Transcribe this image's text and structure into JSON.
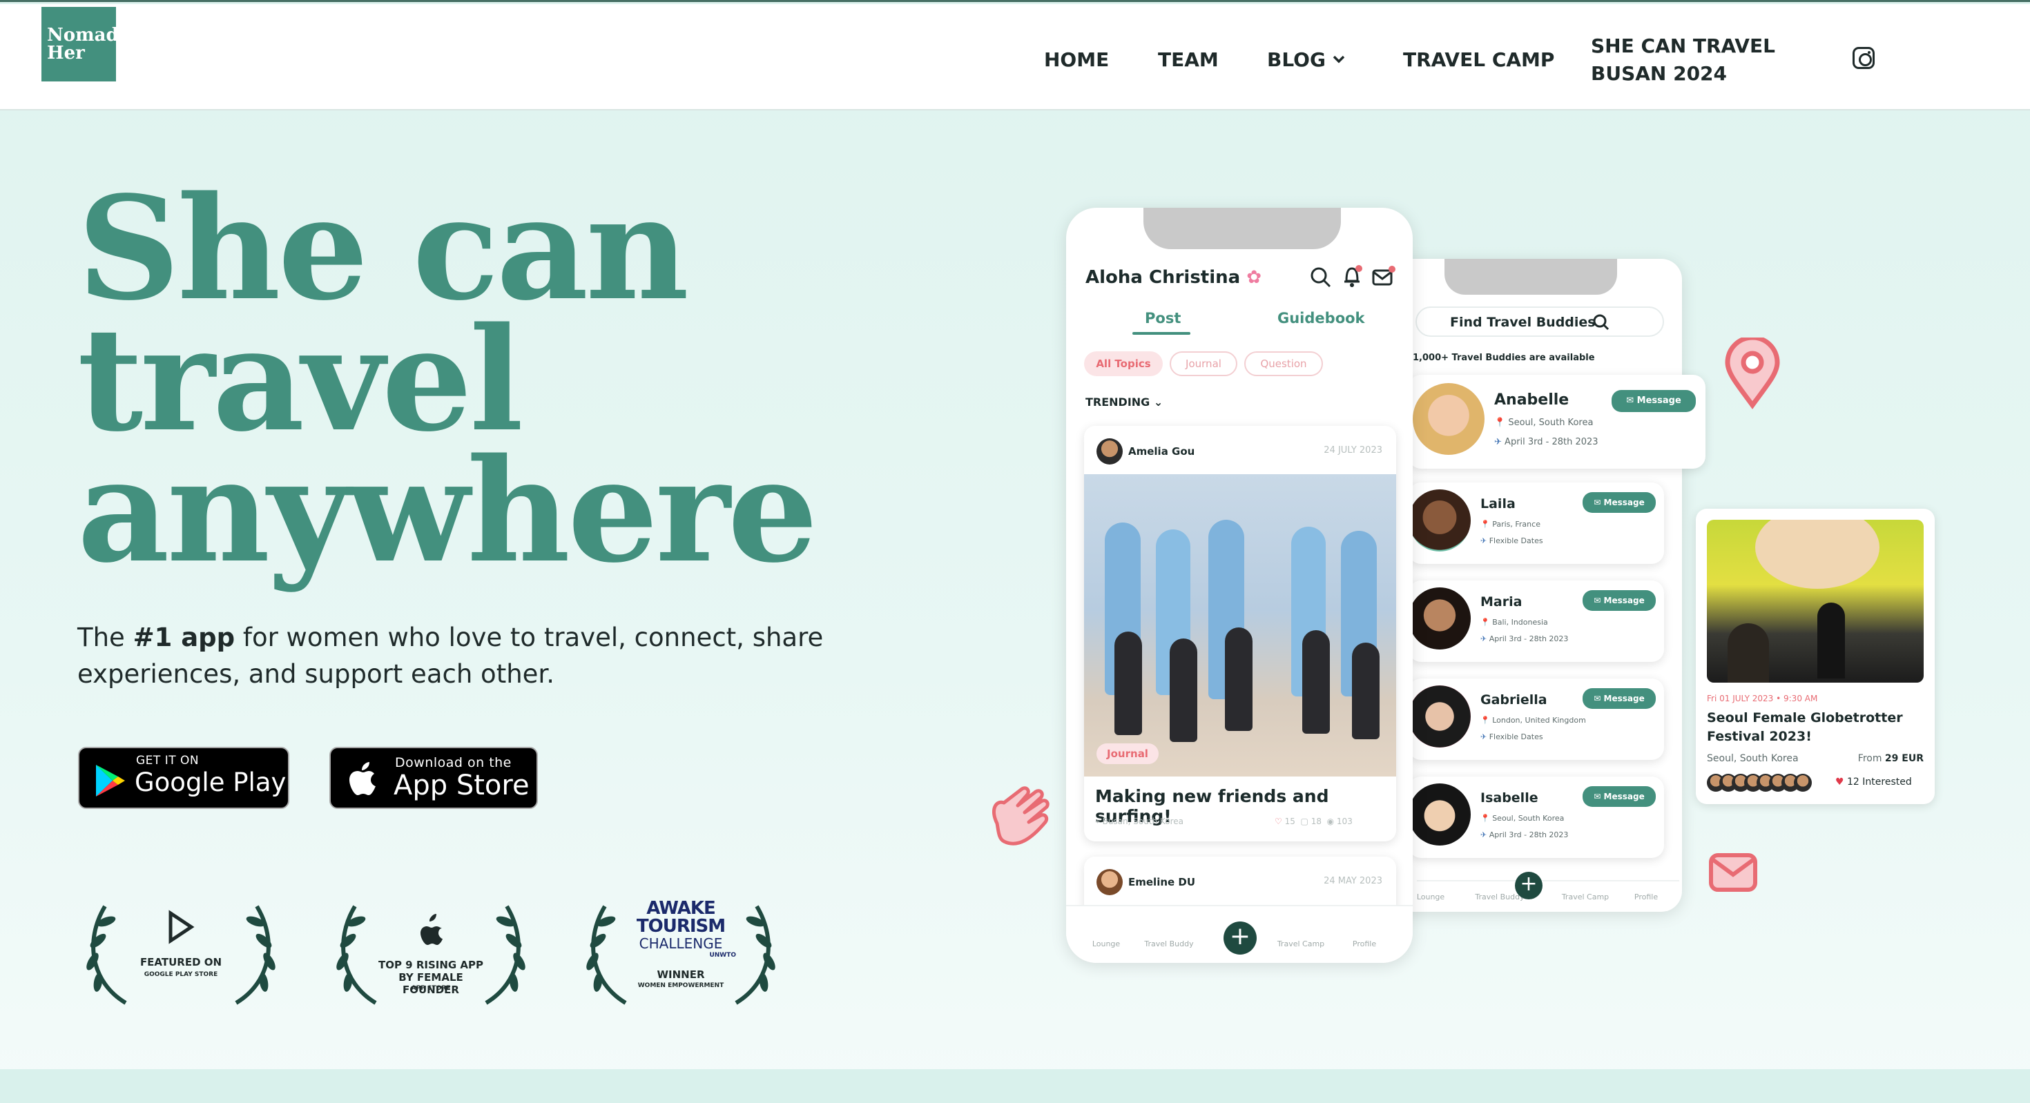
{
  "brand": {
    "logo_line1": "Nomad",
    "logo_line2": "Her",
    "accent": "#43907e"
  },
  "nav": {
    "items": [
      {
        "label": "HOME"
      },
      {
        "label": "TEAM"
      },
      {
        "label": "BLOG"
      },
      {
        "label": "TRAVEL CAMP"
      },
      {
        "label": "SHE CAN TRAVEL"
      }
    ],
    "item_busan": "BUSAN 2024",
    "instagram_icon": "instagram-icon"
  },
  "hero": {
    "title_line1": "She can",
    "title_line2": "travel",
    "title_line3": "anywhere",
    "subtitle_prefix": "The ",
    "subtitle_bold": "#1 app",
    "subtitle_rest": " for women who love to travel, connect, share experiences, and support each other."
  },
  "stores": {
    "google_small": "GET IT ON",
    "google_big": "Google Play",
    "apple_small": "Download on the",
    "apple_big": "App Store"
  },
  "awards": [
    {
      "line1": "FEATURED ON",
      "line2": "GOOGLE PLAY STORE"
    },
    {
      "line1": "TOP 9 RISING APP",
      "line2": "BY FEMALE FOUNDER",
      "line3": "APP STORE"
    },
    {
      "brand1": "AWAKE",
      "brand2": "TOURISM",
      "brand3": "CHALLENGE",
      "org": "UNWTO",
      "line1": "WINNER",
      "line2": "WOMEN EMPOWERMENT"
    }
  ],
  "phone1": {
    "greeting": "Aloha Christina",
    "tabs": [
      "Post",
      "Guidebook"
    ],
    "filters": [
      "All Topics",
      "Journal",
      "Question"
    ],
    "trending": "TRENDING",
    "post": {
      "author": "Amelia Gou",
      "date": "24 JULY 2023",
      "tag": "Journal",
      "title": "Making new friends and surfing!",
      "location": "Busan, South Korea",
      "likes": "15",
      "comments": "18",
      "views": "103"
    },
    "post2": {
      "author": "Emeline DU",
      "date": "24 MAY 2023"
    },
    "bottom_nav": [
      "Lounge",
      "Travel Buddy",
      "Travel Camp",
      "Profile"
    ]
  },
  "phone2": {
    "search_label": "Find Travel Buddies",
    "available": "1,000+ Travel Buddies are available",
    "message_label": "Message",
    "buddies": [
      {
        "name": "Anabelle",
        "location": "Seoul, South Korea",
        "dates": "April 3rd - 28th 2023"
      },
      {
        "name": "Laila",
        "location": "Paris, France",
        "dates": "Flexible Dates"
      },
      {
        "name": "Maria",
        "location": "Bali, Indonesia",
        "dates": "April 3rd - 28th 2023"
      },
      {
        "name": "Gabriella",
        "location": "London, United Kingdom",
        "dates": "Flexible Dates"
      },
      {
        "name": "Isabelle",
        "location": "Seoul, South Korea",
        "dates": "April 3rd - 28th 2023"
      }
    ],
    "bottom_nav": [
      "Lounge",
      "Travel Buddy",
      "Travel Camp",
      "Profile"
    ]
  },
  "event": {
    "date": "Fri 01 JULY 2023 • 9:30 AM",
    "title": "Seoul Female Globetrotter Festival 2023!",
    "location": "Seoul, South Korea",
    "price_prefix": "From ",
    "price": "29 EUR",
    "interested": "12 Interested"
  }
}
